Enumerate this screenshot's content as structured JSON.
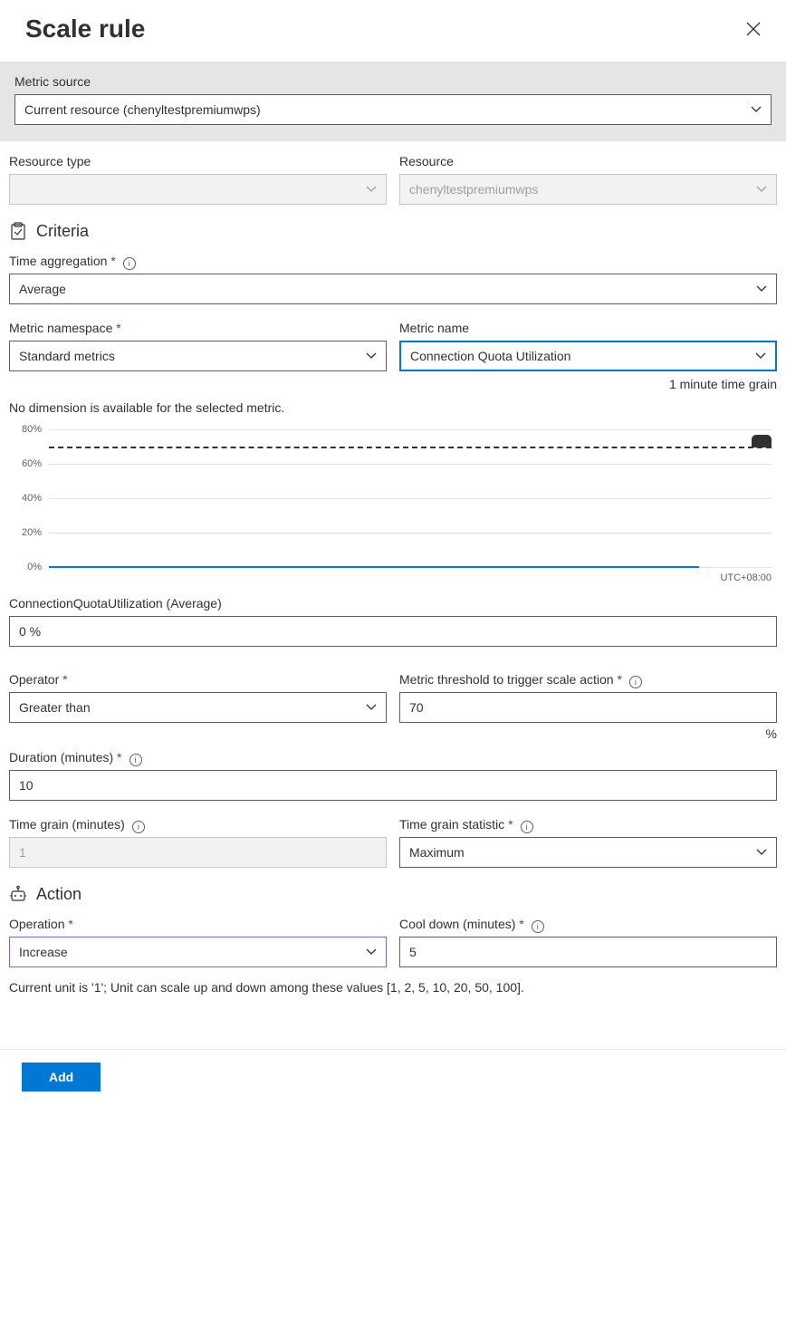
{
  "header": {
    "title": "Scale rule"
  },
  "metric_source": {
    "label": "Metric source",
    "value": "Current resource (chenyltestpremiumwps)"
  },
  "resource_type": {
    "label": "Resource type",
    "value": ""
  },
  "resource": {
    "label": "Resource",
    "value": "chenyltestpremiumwps"
  },
  "criteria": {
    "section_label": "Criteria",
    "time_aggregation": {
      "label": "Time aggregation",
      "value": "Average"
    },
    "metric_namespace": {
      "label": "Metric namespace",
      "value": "Standard metrics"
    },
    "metric_name": {
      "label": "Metric name",
      "value": "Connection Quota Utilization",
      "grain_note": "1 minute time grain"
    },
    "dimension_note": "No dimension is available for the selected metric.",
    "current_metric": {
      "label": "ConnectionQuotaUtilization (Average)",
      "value": "0 %"
    },
    "operator": {
      "label": "Operator",
      "value": "Greater than"
    },
    "threshold": {
      "label": "Metric threshold to trigger scale action",
      "value": "70",
      "unit": "%"
    },
    "duration": {
      "label": "Duration (minutes)",
      "value": "10"
    },
    "time_grain": {
      "label": "Time grain (minutes)",
      "value": "1"
    },
    "time_grain_statistic": {
      "label": "Time grain statistic",
      "value": "Maximum"
    }
  },
  "action": {
    "section_label": "Action",
    "operation": {
      "label": "Operation",
      "value": "Increase"
    },
    "cooldown": {
      "label": "Cool down (minutes)",
      "value": "5"
    },
    "footer_note": "Current unit is '1'; Unit can scale up and down among these values [1, 2, 5, 10, 20, 50, 100]."
  },
  "buttons": {
    "add": "Add"
  },
  "chart_data": {
    "type": "line",
    "metric": "ConnectionQuotaUtilization (Average)",
    "ylabel": "%",
    "ylim": [
      0,
      80
    ],
    "yticks": [
      "0%",
      "20%",
      "40%",
      "60%",
      "80%"
    ],
    "threshold_line": 70,
    "series": [
      {
        "name": "ConnectionQuotaUtilization",
        "value_constant": 0,
        "color": "#0078d4"
      }
    ],
    "timezone": "UTC+08:00"
  }
}
